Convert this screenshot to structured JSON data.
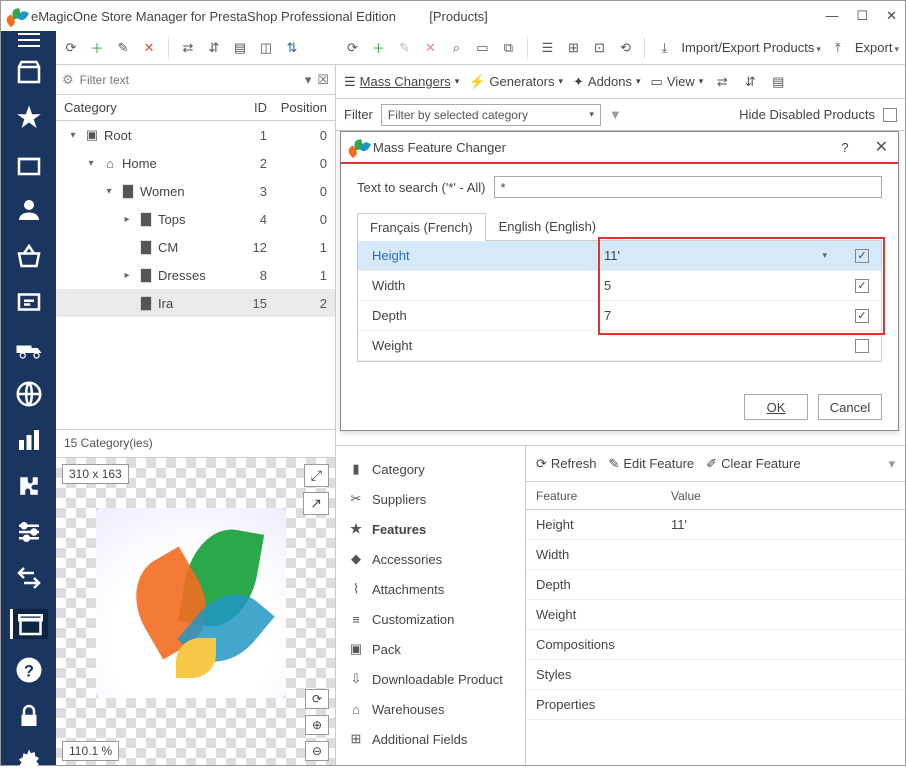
{
  "title": "eMagicOne Store Manager for PrestaShop Professional Edition",
  "title_context": "[Products]",
  "toolbar": {
    "import": "Import/Export Products",
    "export": "Export"
  },
  "rtoolbar": {
    "mass": "Mass Changers",
    "gen": "Generators",
    "addons": "Addons",
    "view": "View"
  },
  "left": {
    "filter_placeholder": "Filter text",
    "headers": [
      "Category",
      "ID",
      "Position"
    ],
    "rows": [
      {
        "name": "Root",
        "id": "1",
        "pos": "0",
        "depth": 0,
        "tw": "▾",
        "icon": "root"
      },
      {
        "name": "Home",
        "id": "2",
        "pos": "0",
        "depth": 1,
        "tw": "▾",
        "icon": "home"
      },
      {
        "name": "Women",
        "id": "3",
        "pos": "0",
        "depth": 2,
        "tw": "▾",
        "icon": "folder"
      },
      {
        "name": "Tops",
        "id": "4",
        "pos": "0",
        "depth": 3,
        "tw": "▸",
        "icon": "folder"
      },
      {
        "name": "CM",
        "id": "12",
        "pos": "1",
        "depth": 3,
        "tw": "",
        "icon": "folder"
      },
      {
        "name": "Dresses",
        "id": "8",
        "pos": "1",
        "depth": 3,
        "tw": "▸",
        "icon": "folder"
      },
      {
        "name": "Ira",
        "id": "15",
        "pos": "2",
        "depth": 3,
        "tw": "",
        "icon": "folder",
        "sel": true
      }
    ],
    "footer": "15 Category(ies)",
    "preview_size": "310 x 163",
    "zoom": "110.1 %"
  },
  "filterrow": {
    "label": "Filter",
    "value": "Filter by selected category",
    "hide": "Hide Disabled Products"
  },
  "dialog": {
    "title": "Mass Feature Changer",
    "help": "?",
    "search_label": "Text to search ('*' - All)",
    "search_value": "*",
    "tabs": [
      "Français (French)",
      "English (English)"
    ],
    "rows": [
      {
        "name": "Height",
        "val": "11'",
        "dd": true,
        "chk": true,
        "sel": true
      },
      {
        "name": "Width",
        "val": "5",
        "chk": true
      },
      {
        "name": "Depth",
        "val": "7",
        "chk": true
      },
      {
        "name": "Weight",
        "val": "",
        "chk": false
      }
    ],
    "ok": "OK",
    "cancel": "Cancel"
  },
  "catlist": [
    "Category",
    "Suppliers",
    "Features",
    "Accessories",
    "Attachments",
    "Customization",
    "Pack",
    "Downloadable Product",
    "Warehouses",
    "Additional Fields"
  ],
  "catlist_icons": [
    "▮",
    "✂",
    "★",
    "◆",
    "⌇",
    "≡",
    "▣",
    "⇩",
    "⌂",
    "⊞"
  ],
  "featpane": {
    "refresh": "Refresh",
    "edit": "Edit Feature",
    "clear": "Clear Feature",
    "headers": [
      "Feature",
      "Value"
    ],
    "rows": [
      {
        "f": "Height",
        "v": "11'"
      },
      {
        "f": "Width",
        "v": ""
      },
      {
        "f": "Depth",
        "v": ""
      },
      {
        "f": "Weight",
        "v": ""
      },
      {
        "f": "Compositions",
        "v": ""
      },
      {
        "f": "Styles",
        "v": ""
      },
      {
        "f": "Properties",
        "v": ""
      }
    ]
  }
}
